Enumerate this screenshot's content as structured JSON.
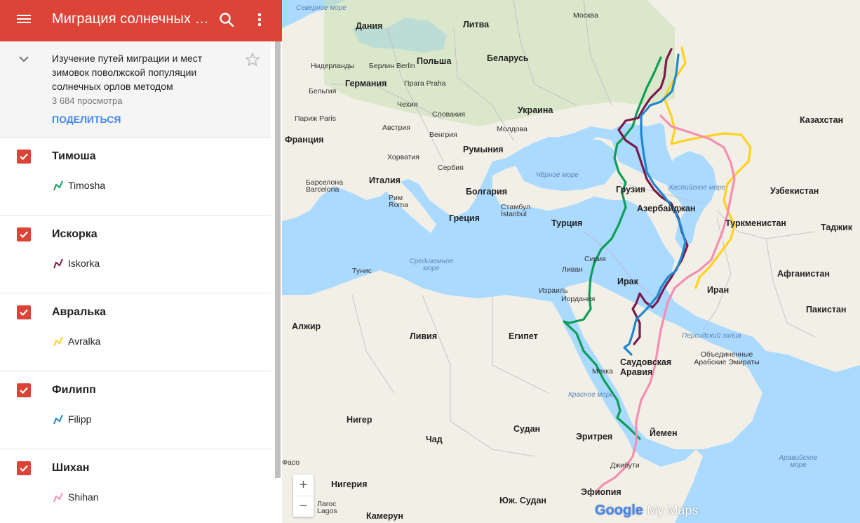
{
  "app": {
    "title": "Миграция солнечных орлов",
    "description": "Изучение путей миграции и мест зимовок поволжской популяции солнечных орлов методом",
    "views": "3 684 просмотра",
    "share_label": "ПОДЕЛИТЬСЯ"
  },
  "icons": {
    "menu": "menu-icon",
    "search": "search-icon",
    "more": "more-vert-icon",
    "collapse": "chevron-down-icon",
    "star": "star-outline-icon"
  },
  "colors": {
    "appbar": "#db4437",
    "share": "#4285f4",
    "timosha": "#0f9d58",
    "iskorka": "#7b1a4b",
    "avralka": "#ffd21f",
    "filipp": "#1e88d0",
    "shihan": "#f48fb1"
  },
  "layers": [
    {
      "name": "Тимоша",
      "feature": "Timosha",
      "color": "#0f9d58",
      "checked": true
    },
    {
      "name": "Искорка",
      "feature": "Iskorka",
      "color": "#7b1a4b",
      "checked": true
    },
    {
      "name": "Авралька",
      "feature": "Avralka",
      "color": "#ffd21f",
      "checked": true
    },
    {
      "name": "Филипп",
      "feature": "Filipp",
      "color": "#1e88d0",
      "checked": true
    },
    {
      "name": "Шихан",
      "feature": "Shihan",
      "color": "#f48fb1",
      "checked": true
    }
  ],
  "map": {
    "labels": {
      "severnoe_more": "Северное море",
      "moskva": "Москва",
      "daniya": "Дания",
      "litva": "Литва",
      "belarus": "Беларусь",
      "niderlandy": "Нидерланды",
      "berlin": "Берлин Berlin",
      "polsha": "Польша",
      "germaniya": "Германия",
      "belgiya": "Бельгия",
      "praga": "Прага Praha",
      "chehiya": "Чехия",
      "ukraina": "Украина",
      "parizh": "Париж Paris",
      "slovakiya": "Словакия",
      "avstriya": "Австрия",
      "vengriya": "Венгрия",
      "moldova": "Молдова",
      "kazahstan": "Казахстан",
      "franciya": "Франция",
      "horvatiya": "Хорватия",
      "rumyniya": "Румыния",
      "serbiya": "Сербия",
      "italiya": "Италия",
      "barselona": "Барселона Barcelona",
      "bolgariya": "Болгария",
      "chernoe_more": "Чёрное море",
      "gruziya": "Грузия",
      "kaspiyskoe_more": "Каспийское море",
      "uzbekistan": "Узбекистан",
      "azerbaydzhan": "Азербайджан",
      "rim": "Рим Roma",
      "stambul": "Стамбул İstanbul",
      "greciya": "Греция",
      "turciya": "Турция",
      "turkmenistan": "Туркменистан",
      "tadzhik": "Таджик",
      "tunis": "Тунис",
      "sredizemnoe": "Средиземное море",
      "siriya": "Сирия",
      "livan": "Ливан",
      "irak": "Ирак",
      "afganistan": "Афганистан",
      "izrail": "Израиль",
      "iordaniya": "Иордания",
      "iran": "Иран",
      "pakistan": "Пакистан",
      "alzhir": "Алжир",
      "liviya": "Ливия",
      "egipet": "Египет",
      "persidskiy": "Персидский залив",
      "oae": "Объединенные Арабские Эмираты",
      "saudovskaya": "Саудовская Аравия",
      "mekka": "Мекка",
      "krasnoe_more": "Красное море",
      "niger": "Нигер",
      "sudan": "Судан",
      "chad": "Чад",
      "eritreya": "Эритрея",
      "yemen": "Йемен",
      "aravijskoe": "Аравийское море",
      "faso": "Фасо",
      "nigeriya": "Нигерия",
      "dzhibuti": "Джибути",
      "efiopiya": "Эфиопия",
      "lagos": "Лагос Lagos",
      "yuzh_sudan": "Юж. Судан",
      "kamerun": "Камерун"
    },
    "zoom_in": "+",
    "zoom_out": "−",
    "brand_google": "Google",
    "brand_mymaps": "My Maps"
  }
}
